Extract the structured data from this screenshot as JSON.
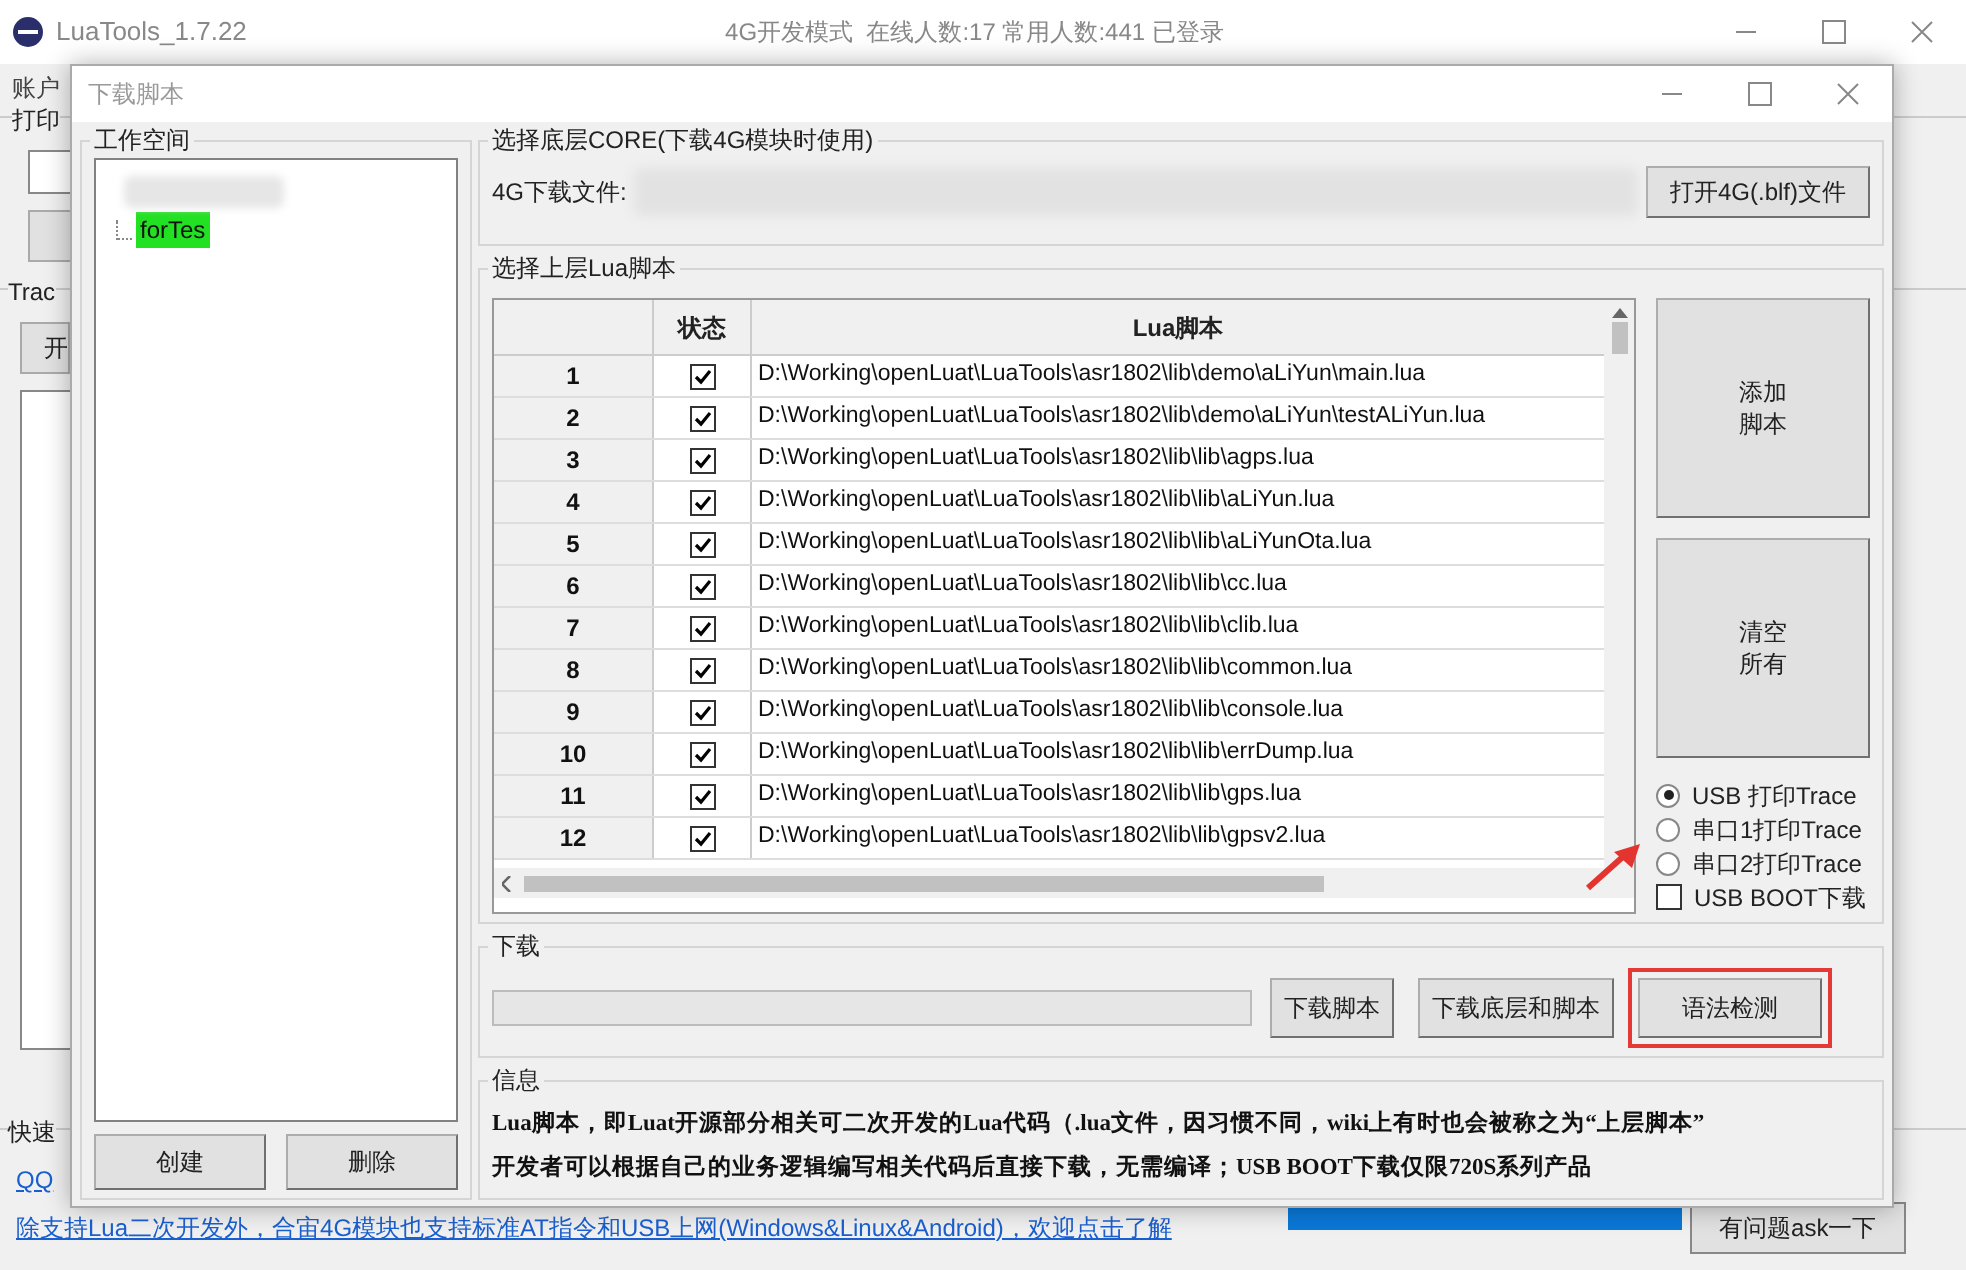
{
  "main_window": {
    "title": "LuaTools_1.7.22",
    "status": "4G开发模式  在线人数:17 常用人数:441 已登录",
    "menu": [
      "账户"
    ],
    "print_group": "打印",
    "trace_group": "Trac",
    "trace_button": "开",
    "quick_group": "快速",
    "qq_link": "QQ",
    "bottom_link": "除支持Lua二次开发外，合宙4G模块也支持标准AT指令和USB上网(Windows&Linux&Android)，欢迎点击了解",
    "ask_button": "有问题ask一下"
  },
  "dialog": {
    "title": "下载脚本",
    "workspace": {
      "title": "工作空间",
      "tree": [
        {
          "label": "forTes",
          "selected": true
        }
      ],
      "buttons": [
        "创建",
        "删除"
      ]
    },
    "core": {
      "title": "选择底层CORE(下载4G模块时使用)",
      "file_label": "4G下载文件:",
      "open_button": "打开4G(.blf)文件"
    },
    "scripts": {
      "title": "选择上层Lua脚本",
      "columns": [
        "状态",
        "Lua脚本"
      ],
      "rows": [
        {
          "index": "1",
          "checked": true,
          "path": "D:\\Working\\openLuat\\LuaTools\\asr1802\\lib\\demo\\aLiYun\\main.lua"
        },
        {
          "index": "2",
          "checked": true,
          "path": "D:\\Working\\openLuat\\LuaTools\\asr1802\\lib\\demo\\aLiYun\\testALiYun.lua"
        },
        {
          "index": "3",
          "checked": true,
          "path": "D:\\Working\\openLuat\\LuaTools\\asr1802\\lib\\lib\\agps.lua"
        },
        {
          "index": "4",
          "checked": true,
          "path": "D:\\Working\\openLuat\\LuaTools\\asr1802\\lib\\lib\\aLiYun.lua"
        },
        {
          "index": "5",
          "checked": true,
          "path": "D:\\Working\\openLuat\\LuaTools\\asr1802\\lib\\lib\\aLiYunOta.lua"
        },
        {
          "index": "6",
          "checked": true,
          "path": "D:\\Working\\openLuat\\LuaTools\\asr1802\\lib\\lib\\cc.lua"
        },
        {
          "index": "7",
          "checked": true,
          "path": "D:\\Working\\openLuat\\LuaTools\\asr1802\\lib\\lib\\clib.lua"
        },
        {
          "index": "8",
          "checked": true,
          "path": "D:\\Working\\openLuat\\LuaTools\\asr1802\\lib\\lib\\common.lua"
        },
        {
          "index": "9",
          "checked": true,
          "path": "D:\\Working\\openLuat\\LuaTools\\asr1802\\lib\\lib\\console.lua"
        },
        {
          "index": "10",
          "checked": true,
          "path": "D:\\Working\\openLuat\\LuaTools\\asr1802\\lib\\lib\\errDump.lua"
        },
        {
          "index": "11",
          "checked": true,
          "path": "D:\\Working\\openLuat\\LuaTools\\asr1802\\lib\\lib\\gps.lua"
        },
        {
          "index": "12",
          "checked": true,
          "path": "D:\\Working\\openLuat\\LuaTools\\asr1802\\lib\\lib\\gpsv2.lua"
        }
      ],
      "side_buttons": [
        [
          "添加",
          "脚本"
        ],
        [
          "清空",
          "所有"
        ]
      ],
      "trace_options": [
        {
          "label": "USB  打印Trace",
          "selected": true
        },
        {
          "label": "串口1打印Trace",
          "selected": false
        },
        {
          "label": "串口2打印Trace",
          "selected": false
        }
      ],
      "usb_boot": {
        "label": "USB BOOT下载",
        "checked": false
      }
    },
    "download": {
      "title": "下载",
      "progress": {
        "level": 0
      },
      "buttons": [
        {
          "label": "下载脚本",
          "highlighted": false
        },
        {
          "label": "下载底层和脚本",
          "highlighted": false
        },
        {
          "label": "语法检测",
          "highlighted": true
        }
      ]
    },
    "info": {
      "title": "信息",
      "lines": [
        "Lua脚本，即Luat开源部分相关可二次开发的Lua代码（.lua文件，因习惯不同，wiki上有时也会被称之为“上层脚本”",
        "开发者可以根据自己的业务逻辑编写相关代码后直接下载，无需编译；USB BOOT下载仅限720S系列产品"
      ]
    }
  }
}
